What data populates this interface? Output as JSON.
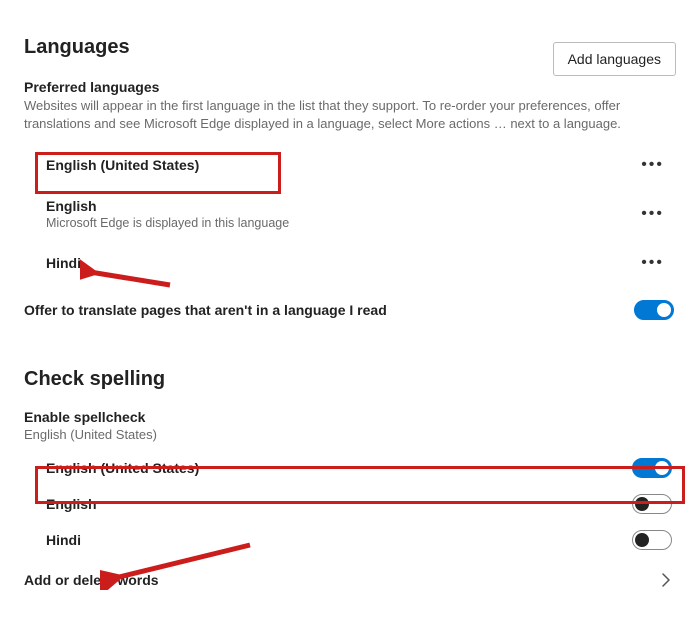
{
  "languages": {
    "title": "Languages",
    "add_button": "Add languages",
    "preferred_heading": "Preferred languages",
    "preferred_desc": "Websites will appear in the first language in the list that they support. To re-order your preferences, offer translations and see Microsoft Edge displayed in a language, select More actions … next to a language.",
    "items": [
      {
        "name": "English (United States)",
        "sub": ""
      },
      {
        "name": "English",
        "sub": "Microsoft Edge is displayed in this language"
      },
      {
        "name": "Hindi",
        "sub": ""
      }
    ],
    "offer_translate": "Offer to translate pages that aren't in a language I read"
  },
  "spelling": {
    "title": "Check spelling",
    "enable_heading": "Enable spellcheck",
    "enable_desc": "English (United States)",
    "items": [
      {
        "name": "English (United States)",
        "on": true
      },
      {
        "name": "English",
        "on": false
      },
      {
        "name": "Hindi",
        "on": false
      }
    ],
    "add_words": "Add or delete words"
  }
}
